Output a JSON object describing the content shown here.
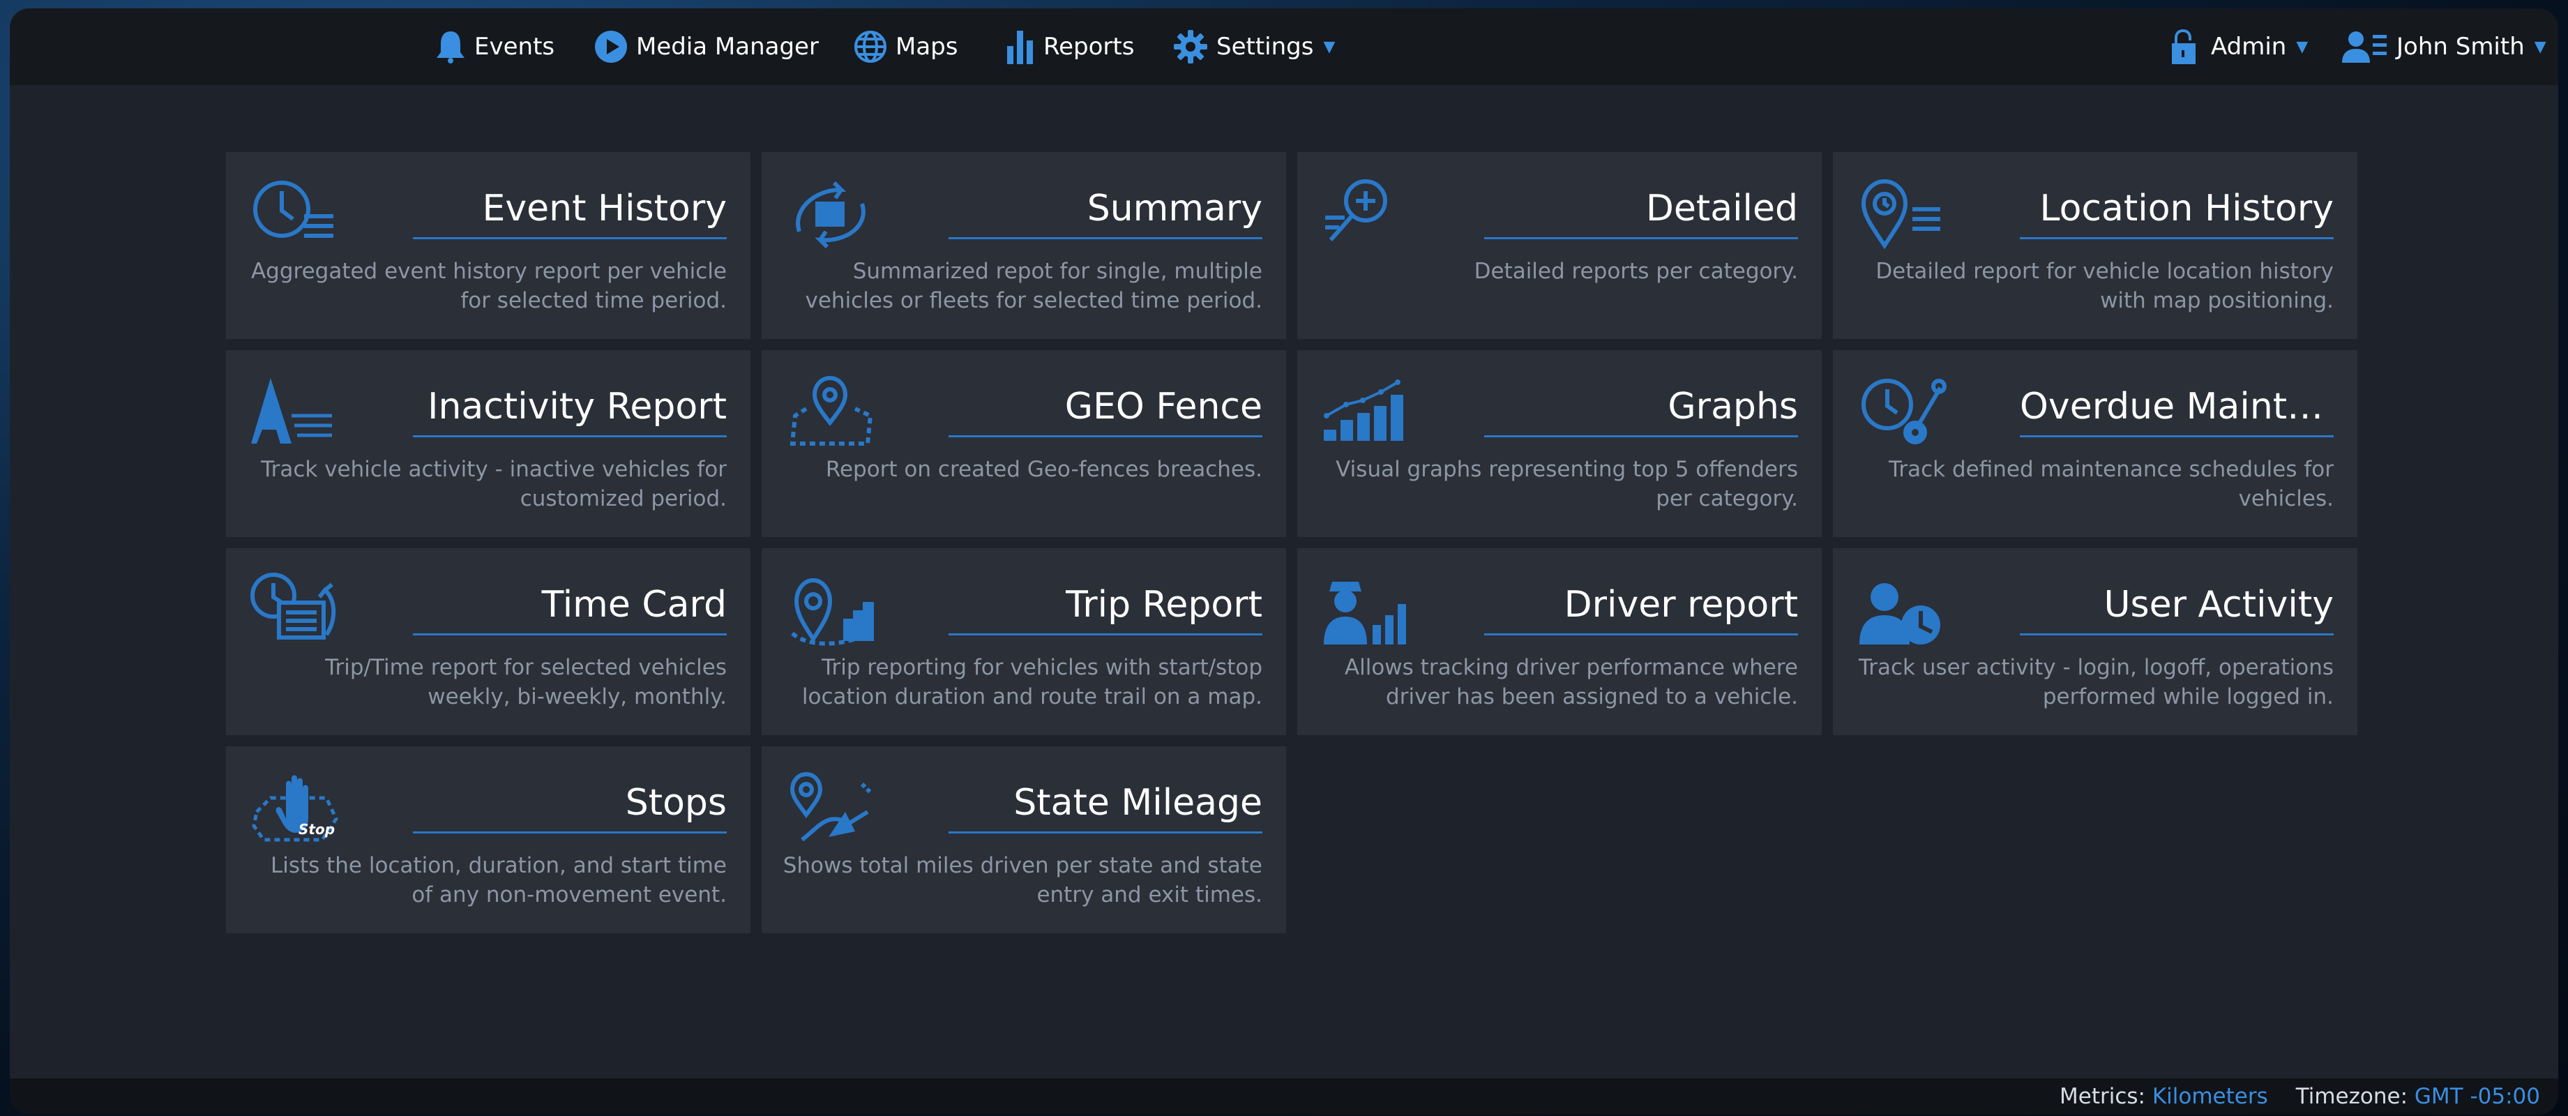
{
  "nav": {
    "events": "Events",
    "media": "Media Manager",
    "maps": "Maps",
    "reports": "Reports",
    "settings": "Settings",
    "admin": "Admin",
    "user": "John Smith"
  },
  "cards": [
    {
      "title": "Event History",
      "desc": "Aggregated event history report per vehicle for selected time period.",
      "icon": "clock-list-icon"
    },
    {
      "title": "Summary",
      "desc": "Summarized repot for single, multiple vehicles or fleets for selected time period.",
      "icon": "summary-arrows-icon"
    },
    {
      "title": "Detailed",
      "desc": "Detailed reports per category.",
      "icon": "magnify-plus-icon"
    },
    {
      "title": "Location History",
      "desc": "Detailed report for vehicle location history with map positioning.",
      "icon": "pin-clock-icon"
    },
    {
      "title": "Inactivity Report",
      "desc": "Track vehicle activity - inactive vehicles for customized period.",
      "icon": "inactivity-icon"
    },
    {
      "title": "GEO Fence",
      "desc": "Report on created Geo-fences breaches.",
      "icon": "geofence-icon"
    },
    {
      "title": "Graphs",
      "desc": "Visual graphs representing top 5 offenders per category.",
      "icon": "bar-graph-icon"
    },
    {
      "title": "Overdue Mainten...",
      "desc": "Track defined maintenance schedules for vehicles.",
      "icon": "maintenance-icon"
    },
    {
      "title": "Time Card",
      "desc": "Trip/Time report for selected vehicles weekly, bi-weekly, monthly.",
      "icon": "time-card-icon"
    },
    {
      "title": "Trip Report",
      "desc": "Trip reporting for vehicles with start/stop location duration and route trail on a map.",
      "icon": "trip-pin-icon"
    },
    {
      "title": "Driver report",
      "desc": "Allows tracking driver performance where driver has been assigned to a vehicle.",
      "icon": "driver-icon"
    },
    {
      "title": "User Activity",
      "desc": "Track user activity - login, logoff, operations performed while logged in.",
      "icon": "user-activity-icon"
    },
    {
      "title": "Stops",
      "desc": "Lists the location, duration, and start time of any non-movement event.",
      "icon": "stop-hand-icon"
    },
    {
      "title": "State Mileage",
      "desc": "Shows total miles driven per state and state entry and exit times.",
      "icon": "state-mileage-icon"
    }
  ],
  "footer": {
    "metrics_label": "Metrics:",
    "metrics_value": "Kilometers",
    "timezone_label": "Timezone:",
    "timezone_value": "GMT -05:00"
  },
  "colors": {
    "accent": "#2a78c8",
    "card_bg": "#2a2f38",
    "page_bg": "#1e232b"
  }
}
